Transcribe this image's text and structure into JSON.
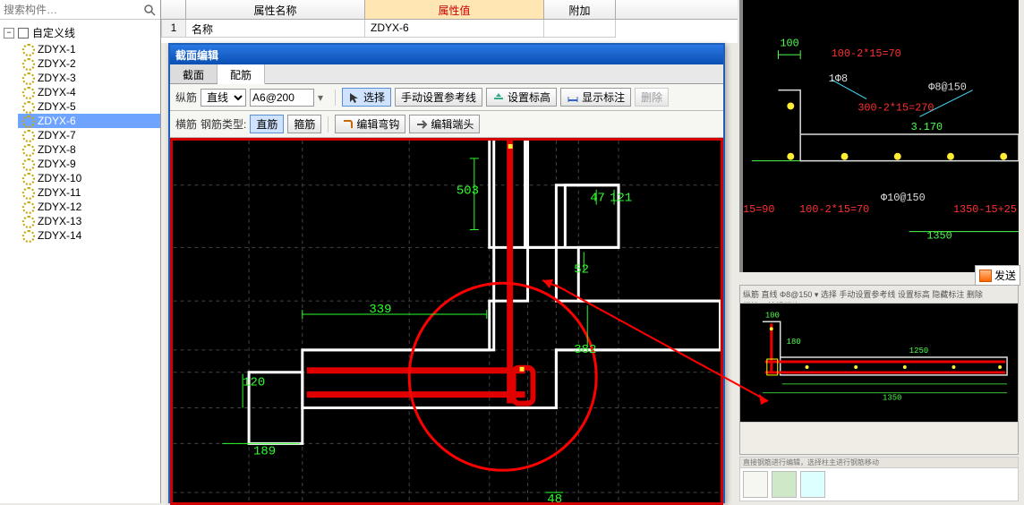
{
  "search": {
    "placeholder": "搜索构件…"
  },
  "tree": {
    "root_label": "自定义线",
    "items": [
      "ZDYX-1",
      "ZDYX-2",
      "ZDYX-3",
      "ZDYX-4",
      "ZDYX-5",
      "ZDYX-6",
      "ZDYX-7",
      "ZDYX-8",
      "ZDYX-9",
      "ZDYX-10",
      "ZDYX-11",
      "ZDYX-12",
      "ZDYX-13",
      "ZDYX-14"
    ],
    "selected_index": 5
  },
  "props": {
    "headers": {
      "name": "属性名称",
      "value": "属性值",
      "extra": "附加"
    },
    "row1": {
      "num": "1",
      "name": "名称",
      "value": "ZDYX-6"
    }
  },
  "dialog": {
    "title": "截面编辑",
    "tabs": [
      "截面",
      "配筋"
    ],
    "active_tab": 1,
    "toolbar1": {
      "vbar_label": "纵筋",
      "line_type": "直线",
      "spec": "A6@200",
      "select": "选择",
      "manual_ref": "手动设置参考线",
      "set_elev": "设置标高",
      "show_dim": "显示标注",
      "delete": "删除"
    },
    "toolbar2": {
      "hbar_label": "横筋",
      "type_label": "钢筋类型:",
      "straight": "直筋",
      "stirrup": "箍筋",
      "edit_hook": "编辑弯钩",
      "edit_end": "编辑端头"
    }
  },
  "canvas_dims": {
    "d503": "503",
    "d47": "47",
    "d121": "121",
    "d52": "52",
    "d339": "339",
    "d382": "382",
    "d120": "120",
    "d189": "189",
    "d48": "48"
  },
  "cad_panel": {
    "t100": "100",
    "t100_calc": "100-2*15=70",
    "t1phi8": "1Φ8",
    "t_phi8_150": "Φ8@150",
    "t300_calc": "300-2*15=270",
    "t_3170": "3.170",
    "t_phi10_150": "Φ10@150",
    "t15_90": "15=90",
    "t100_calc2": "100-2*15=70",
    "t1350_calc": "1350-15+25",
    "t1350": "1350"
  },
  "thumb": {
    "dim100": "100",
    "dim180": "180",
    "dim1250": "1250",
    "dim1350": "1350"
  },
  "send_btn": "发送",
  "right_bot_hint": "直接钢筋进行编辑，选择柱主进行钢筋移动"
}
